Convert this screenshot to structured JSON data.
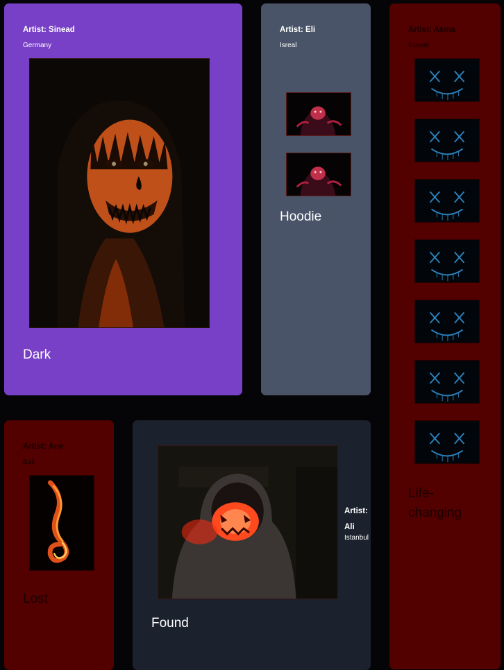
{
  "cards": {
    "sinead": {
      "artist": "Artist: Sinead",
      "location": "Germany",
      "title": "Dark",
      "image_icon": "pumpkin-face-painted-woman"
    },
    "eli": {
      "artist": "Artist: Eli",
      "location": "Isreal",
      "title": "Hoodie",
      "image_icon": "red-hoodie-mask"
    },
    "asma": {
      "artist": "Artist: Asma",
      "location": "Kuwait",
      "title": "Life-changing",
      "image_icon": "neon-blue-mask"
    },
    "ane": {
      "artist": "Artist: Ane",
      "location": "Bali",
      "title": "Lost",
      "image_icon": "fire-swirl"
    },
    "ali": {
      "artist": "Artist: Ali",
      "location": "Istanbul",
      "title": "Found",
      "image_icon": "glowing-pumpkin-hoodie"
    }
  },
  "colors": {
    "page_background": "#050508",
    "purple_card": "#7740c6",
    "slate_card": "#4a5468",
    "maroon_card": "#520000",
    "navy_card": "#1b212d"
  }
}
